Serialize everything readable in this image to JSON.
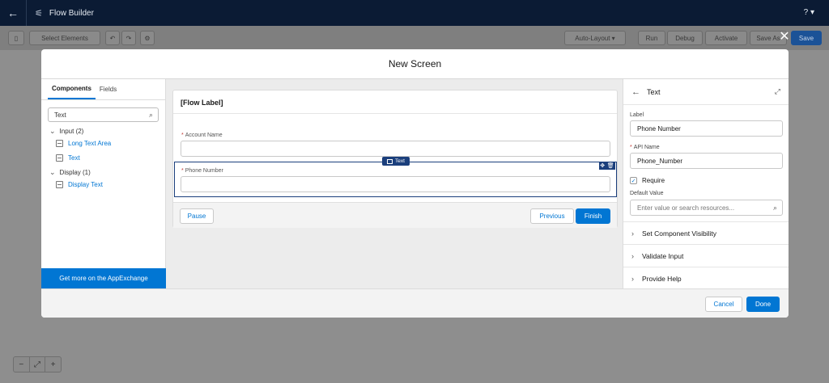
{
  "app": {
    "title": "Flow Builder",
    "help": "?"
  },
  "toolbar": {
    "select_elements": "Select Elements",
    "layout": "Auto-Layout",
    "run": "Run",
    "debug": "Debug",
    "activate": "Activate",
    "save_as": "Save As",
    "save": "Save"
  },
  "modal": {
    "title": "New Screen",
    "close": "✕",
    "left": {
      "tabs": [
        "Components",
        "Fields"
      ],
      "search_value": "Text",
      "groups": [
        {
          "label": "Input (2)",
          "items": [
            "Long Text Area",
            "Text"
          ]
        },
        {
          "label": "Display (1)",
          "items": [
            "Display Text"
          ]
        }
      ],
      "appexchange": "Get more on the AppExchange"
    },
    "canvas": {
      "flow_label": "[Flow Label]",
      "fields": [
        {
          "label": "Account Name",
          "required": "*"
        },
        {
          "label": "Phone Number",
          "required": "*"
        }
      ],
      "selected_tag": "Text",
      "pause": "Pause",
      "previous": "Previous",
      "finish": "Finish"
    },
    "right": {
      "title": "Text",
      "label_caption": "Label",
      "label_value": "Phone Number",
      "api_caption": "API Name",
      "api_value": "Phone_Number",
      "required_mark": "*",
      "require_label": "Require",
      "default_caption": "Default Value",
      "default_placeholder": "Enter value or search resources...",
      "sections": [
        "Set Component Visibility",
        "Validate Input",
        "Provide Help"
      ]
    },
    "footer": {
      "cancel": "Cancel",
      "done": "Done"
    }
  },
  "zoom": {
    "minus": "−",
    "fit": "⤢",
    "plus": "+"
  }
}
